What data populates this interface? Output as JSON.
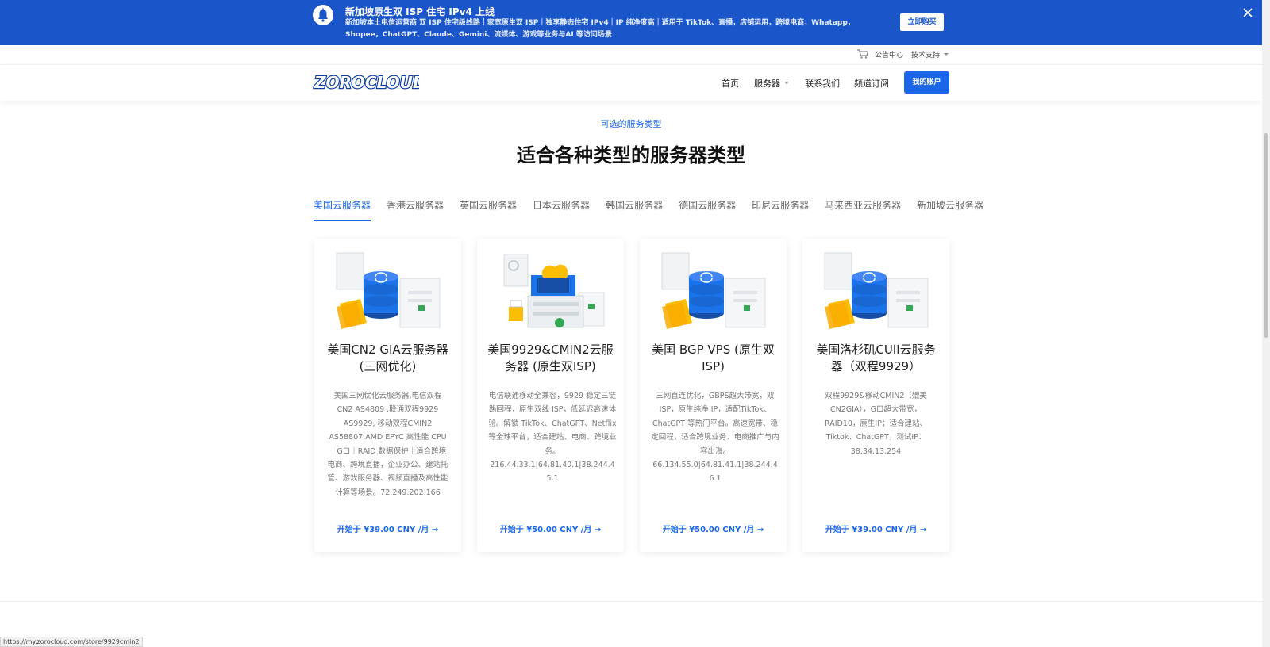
{
  "banner": {
    "title": "新加坡原生双 ISP 住宅 IPv4 上线",
    "description": "新加坡本土电信运营商 双 ISP 住宅级线路｜家宽原生双 ISP｜独享静态住宅 IPv4｜IP 纯净度高｜适用于 TikTok、直播，店铺运用，跨境电商，Whatapp，Shopee，ChatGPT、Claude、Gemini、流媒体、游戏等业务与AI 等访问场景",
    "button": "立即购买",
    "icon": "bell-icon",
    "close_icon": "close-icon"
  },
  "topbar": {
    "announcements": "公告中心",
    "support": "技术支持"
  },
  "header": {
    "logo": "ZOROCLOUD",
    "nav": [
      "首页",
      "服务器",
      "联系我们",
      "频道订阅"
    ],
    "account_button": "我的账户"
  },
  "section": {
    "kicker": "可选的服务类型",
    "headline": "适合各种类型的服务器类型"
  },
  "tabs": [
    "美国云服务器",
    "香港云服务器",
    "英国云服务器",
    "日本云服务器",
    "韩国云服务器",
    "德国云服务器",
    "印尼云服务器",
    "马来西亚云服务器",
    "新加坡云服务器"
  ],
  "active_tab": "美国云服务器",
  "cards": [
    {
      "title": "美国CN2 GIA云服务器(三网优化)",
      "description": "美国三网优化云服务器,电信双程CN2 AS4809 ,联通双程9929 AS9929, 移动双程CMIN2 AS58807,AMD EPYC 高性能 CPU｜G口｜RAID 数据保护｜适合跨境电商、跨境直播，企业办公、建站托管、游戏服务器、视频直播及高性能计算等场景。72.249.202.166",
      "price": "开始于 ¥39.00 CNY /月",
      "illustration": "database-icon"
    },
    {
      "title": "美国9929&CMIN2云服务器 (原生双ISP)",
      "description": "电信联通移动全兼容，9929 稳定三链路回程，原生双线 ISP，低延迟高速体验。解锁 TikTok、ChatGPT、Netflix 等全球平台，适合建站、电商、跨境业务。\n216.44.33.1|64.81.40.1|38.244.45.1",
      "price": "开始于 ¥50.00 CNY /月",
      "illustration": "cloud-server-icon"
    },
    {
      "title": "美国 BGP VPS (原生双ISP)",
      "description": "三网直连优化，GBPS超大带宽，双ISP，原生纯净 IP，适配TikTok、ChatGPT 等热门平台。高速宽带、稳定回程，适合跨境业务、电商推广与内容出海。\n66.134.55.0|64.81.41.1|38.244.46.1",
      "price": "开始于 ¥50.00 CNY /月",
      "illustration": "database-icon"
    },
    {
      "title": "美国洛杉矶CUII云服务器（双程9929）",
      "description": "双程9929&移动CMIN2（媲美CN2GIA），G口超大带宽，RAID10，原生IP；适合建站、Tiktok、ChatGPT，测试IP：38.34.13.254",
      "price": "开始于 ¥39.00 CNY /月",
      "illustration": "database-icon"
    }
  ],
  "status_url": "https://my.zorocloud.com/store/9929cmin2",
  "colors": {
    "primary": "#1b66e8",
    "banner": "#1a56c9"
  }
}
